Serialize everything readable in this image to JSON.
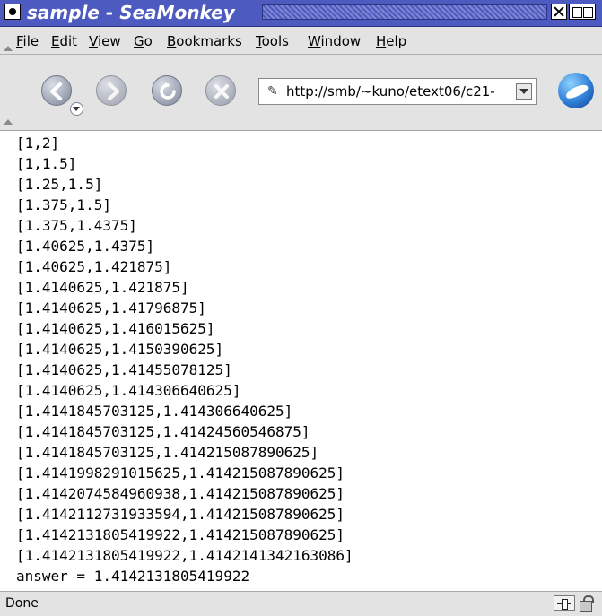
{
  "window": {
    "title": "sample - SeaMonkey"
  },
  "menubar": {
    "items": [
      {
        "label": "File",
        "underline": "F",
        "rest": "ile"
      },
      {
        "label": "Edit",
        "underline": "E",
        "rest": "dit"
      },
      {
        "label": "View",
        "underline": "V",
        "rest": "iew"
      },
      {
        "label": "Go",
        "underline": "G",
        "rest": "o"
      },
      {
        "label": "Bookmarks",
        "underline": "B",
        "rest": "ookmarks"
      },
      {
        "label": "Tools",
        "underline": "T",
        "rest": "ools"
      },
      {
        "label": "Window",
        "underline": "W",
        "rest": "indow"
      },
      {
        "label": "Help",
        "underline": "H",
        "rest": "elp"
      }
    ]
  },
  "toolbar": {
    "back_icon": "back-arrow-icon",
    "forward_icon": "forward-arrow-icon",
    "reload_icon": "reload-icon",
    "stop_icon": "stop-icon",
    "url": "http://smb/~kuno/etext06/c21-",
    "throbber_icon": "seamonkey-logo"
  },
  "content": {
    "lines": [
      "[1,2]",
      "[1,1.5]",
      "[1.25,1.5]",
      "[1.375,1.5]",
      "[1.375,1.4375]",
      "[1.40625,1.4375]",
      "[1.40625,1.421875]",
      "[1.4140625,1.421875]",
      "[1.4140625,1.41796875]",
      "[1.4140625,1.416015625]",
      "[1.4140625,1.4150390625]",
      "[1.4140625,1.41455078125]",
      "[1.4140625,1.414306640625]",
      "[1.4141845703125,1.414306640625]",
      "[1.4141845703125,1.41424560546875]",
      "[1.4141845703125,1.414215087890625]",
      "[1.4141998291015625,1.414215087890625]",
      "[1.4142074584960938,1.414215087890625]",
      "[1.4142112731933594,1.414215087890625]",
      "[1.4142131805419922,1.414215087890625]",
      "[1.4142131805419922,1.4142141342163086]",
      "answer = 1.4142131805419922"
    ]
  },
  "statusbar": {
    "text": "Done",
    "icons": [
      "connection-icon",
      "lock-icon"
    ]
  }
}
